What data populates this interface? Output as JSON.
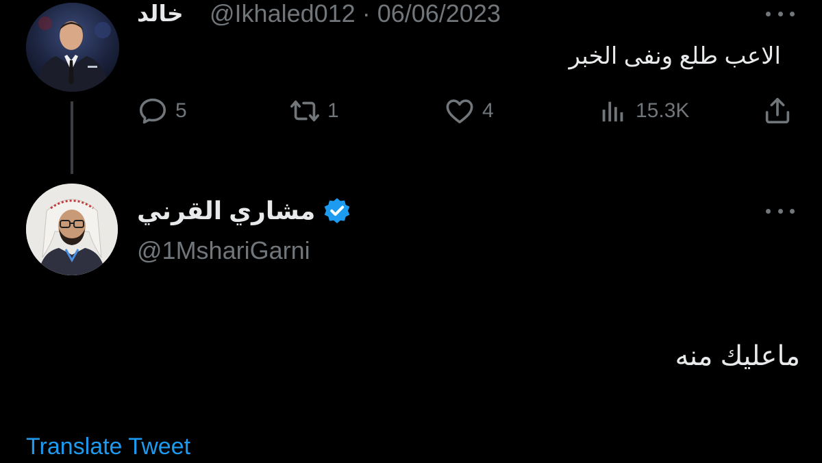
{
  "tweet1": {
    "display_name": "خالد",
    "handle_and_date": "@Ikhaled012 · 06/06/2023",
    "text": "الاعب طلع ونفى الخبر",
    "replies": "5",
    "retweets": "1",
    "likes": "4",
    "views": "15.3K",
    "avatar_icon": "profile-photo-man-suit"
  },
  "tweet2": {
    "display_name": "مشاري القرني",
    "handle": "@1MshariGarni",
    "verified": true,
    "text": "ماعليك منه",
    "translate_label": "Translate Tweet",
    "avatar_icon": "profile-photo-man-shemagh"
  },
  "colors": {
    "background": "#000000",
    "primary_text": "#e7e9ea",
    "secondary_text": "#71767b",
    "accent": "#1d9bf0"
  }
}
